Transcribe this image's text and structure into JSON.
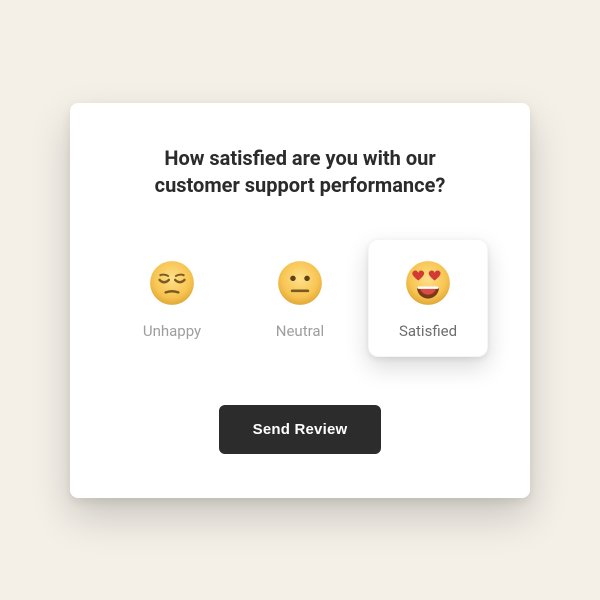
{
  "title": "How satisfied are you with our customer support performance?",
  "options": [
    {
      "label": "Unhappy"
    },
    {
      "label": "Neutral"
    },
    {
      "label": "Satisfied"
    }
  ],
  "selected_index": 2,
  "button_label": "Send Review"
}
